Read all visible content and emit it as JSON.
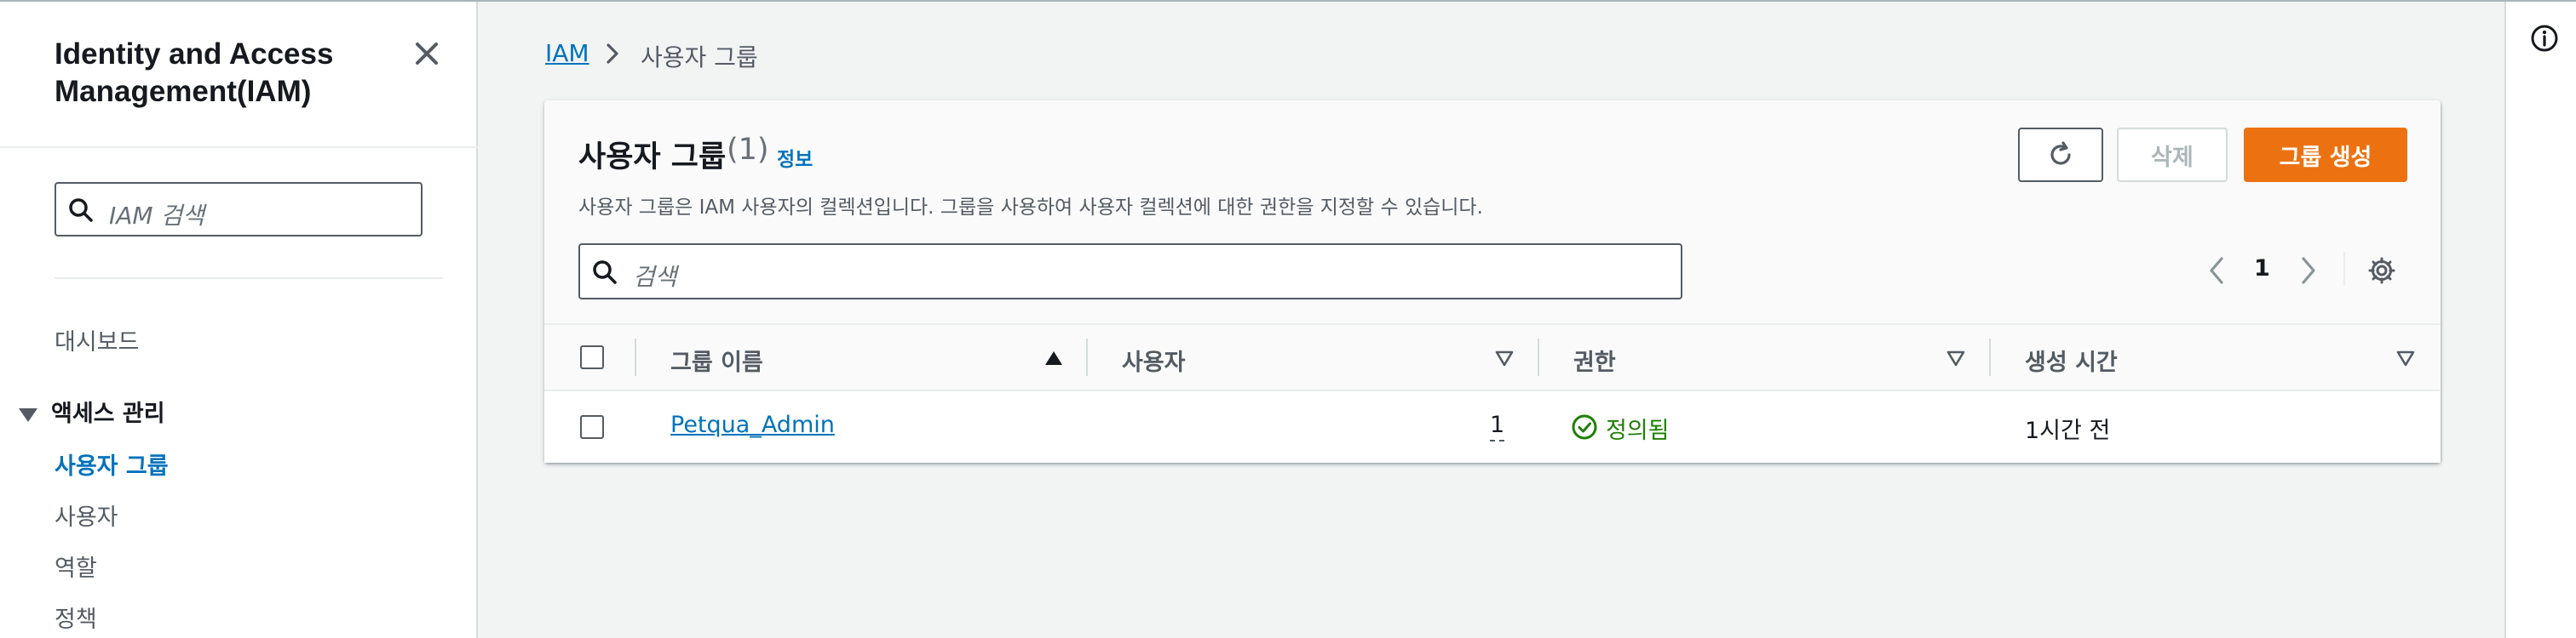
{
  "sidebar": {
    "title": "Identity and Access Management(IAM)",
    "search_placeholder": "IAM 검색",
    "items": [
      {
        "label": "대시보드"
      },
      {
        "label": "액세스 관리"
      },
      {
        "label": "사용자 그룹"
      },
      {
        "label": "사용자"
      },
      {
        "label": "역할"
      },
      {
        "label": "정책"
      }
    ]
  },
  "breadcrumb": {
    "root": "IAM",
    "current": "사용자 그룹"
  },
  "panel": {
    "title": "사용자 그룹",
    "count": "(1)",
    "info_link": "정보",
    "description": "사용자 그룹은 IAM 사용자의 컬렉션입니다. 그룹을 사용하여 사용자 컬렉션에 대한 권한을 지정할 수 있습니다.",
    "delete_label": "삭제",
    "create_label": "그룹 생성",
    "search_placeholder": "검색",
    "page_number": "1"
  },
  "table": {
    "columns": [
      "그룹 이름",
      "사용자",
      "권한",
      "생성 시간"
    ],
    "rows": [
      {
        "name": "Petqua_Admin",
        "users": "1",
        "permissions": "정의됨",
        "created": "1시간 전"
      }
    ]
  },
  "colors": {
    "accent": "#0073bb",
    "primary_button": "#ec7211",
    "success": "#1d8102"
  }
}
